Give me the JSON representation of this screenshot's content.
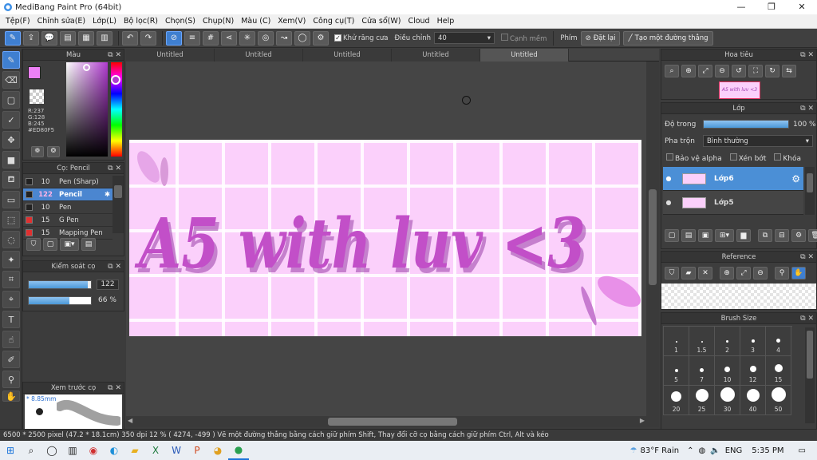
{
  "window": {
    "title": "MediBang Paint Pro (64bit)",
    "minimize": "—",
    "restore": "❐",
    "close": "✕"
  },
  "menu": [
    "Tệp(F)",
    "Chỉnh sửa(E)",
    "Lớp(L)",
    "Bộ lọc(R)",
    "Chọn(S)",
    "Chụp(N)",
    "Màu (C)",
    "Xem(V)",
    "Công cụ(T)",
    "Cửa sổ(W)",
    "Cloud",
    "Help"
  ],
  "toolbar": {
    "antialias_label": "Khử răng cưa",
    "adjust_label": "Điều chỉnh",
    "adjust_value": "40",
    "smooth_label": "Cạnh mềm",
    "shortcut_label": "Phím",
    "reset_label": "Đặt lại",
    "straight_line_label": "Tạo một đường thẳng"
  },
  "color_panel": {
    "title": "Màu",
    "r": "R:237",
    "g": "G:128",
    "b": "B:245",
    "hex": "#ED80F5",
    "primary_color": "#ED80F5",
    "secondary_color": "#F5C842"
  },
  "brush_panel": {
    "title": "Cọ: Pencil",
    "items": [
      {
        "size": "10",
        "name": "Pen (Sharp)",
        "color": "#222222",
        "selected": false
      },
      {
        "size": "122",
        "name": "Pencil",
        "color": "#222222",
        "selected": true
      },
      {
        "size": "10",
        "name": "Pen",
        "color": "#222222",
        "selected": false
      },
      {
        "size": "15",
        "name": "G Pen",
        "color": "#e03030",
        "selected": false
      },
      {
        "size": "15",
        "name": "Mapping Pen",
        "color": "#e03030",
        "selected": false
      }
    ]
  },
  "brush_control": {
    "title": "Kiểm soát cọ",
    "size_value": "122",
    "size_fraction": 0.95,
    "opacity_value": "66 %",
    "opacity_fraction": 0.66
  },
  "brush_preview": {
    "title": "Xem trước cọ",
    "size_text": "* 8.85mm"
  },
  "tabs": [
    {
      "label": "Untitled",
      "active": false
    },
    {
      "label": "Untitled",
      "active": false
    },
    {
      "label": "Untitled",
      "active": false
    },
    {
      "label": "Untitled",
      "active": false
    },
    {
      "label": "Untitled",
      "active": true
    }
  ],
  "canvas": {
    "text_main": "A5 with luv <3",
    "background_color": "#FBD0FB",
    "grid_color": "#FFFFFF",
    "text_color": "#C24FC8"
  },
  "navigator": {
    "title": "Hoa tiêu",
    "thumb_text": "A5 with luv <3"
  },
  "layer_panel": {
    "title": "Lớp",
    "opacity_label": "Độ trong",
    "opacity_value": "100 %",
    "opacity_fraction": 1.0,
    "blend_label": "Pha trộn",
    "blend_value": "Bình thường",
    "protect_alpha": "Bảo vệ alpha",
    "clipping": "Xén bớt",
    "lock": "Khóa",
    "layers": [
      {
        "name": "Lớp6",
        "selected": true
      },
      {
        "name": "Lớp5",
        "selected": false
      }
    ]
  },
  "reference_panel": {
    "title": "Reference"
  },
  "brush_size_panel": {
    "title": "Brush Size",
    "sizes": [
      "1",
      "1.5",
      "2",
      "3",
      "4",
      "5",
      "7",
      "10",
      "12",
      "15",
      "20",
      "25",
      "30",
      "40",
      "50"
    ]
  },
  "status": {
    "text": "6500 * 2500 pixel   (47.2 * 18.1cm)   350 dpi   12 %   ( 4274, -499 )   Vẽ một đường thẳng bằng cách giữ phím Shift, Thay đổi cỡ cọ bằng cách giữ phím Ctrl, Alt và kéo"
  },
  "taskbar": {
    "weather": "83°F  Rain",
    "lang": "ENG",
    "time": "5:35 PM"
  }
}
